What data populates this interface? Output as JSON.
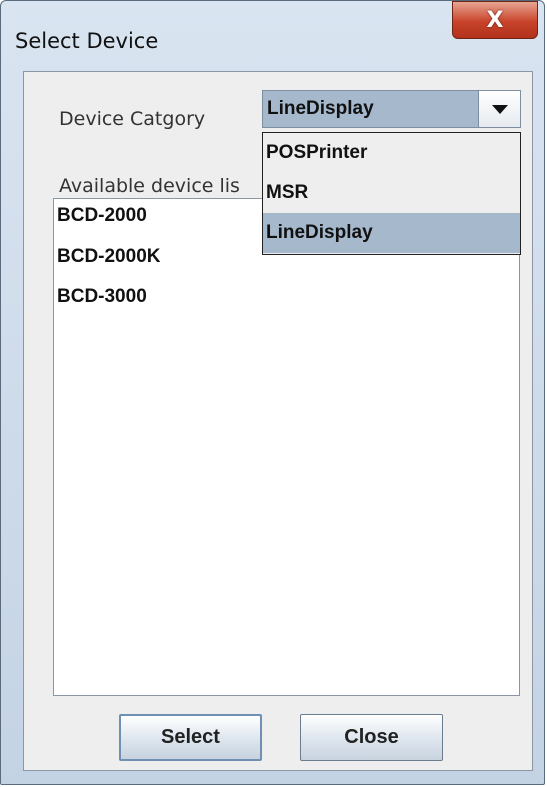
{
  "window": {
    "title": "Select Device",
    "close_glyph": "X"
  },
  "category": {
    "label": "Device Catgory",
    "selected": "LineDisplay",
    "options": [
      "POSPrinter",
      "MSR",
      "LineDisplay"
    ]
  },
  "devices": {
    "label": "Available device lis",
    "items": [
      "BCD-2000",
      "BCD-2000K",
      "BCD-3000"
    ]
  },
  "buttons": {
    "select_label": "Select",
    "close_label": "Close"
  },
  "icons": {
    "close": "close-x-icon",
    "dropdown": "chevron-down-icon"
  },
  "colors": {
    "selection": "#a5b8cc",
    "close_button": "#c8432a"
  }
}
